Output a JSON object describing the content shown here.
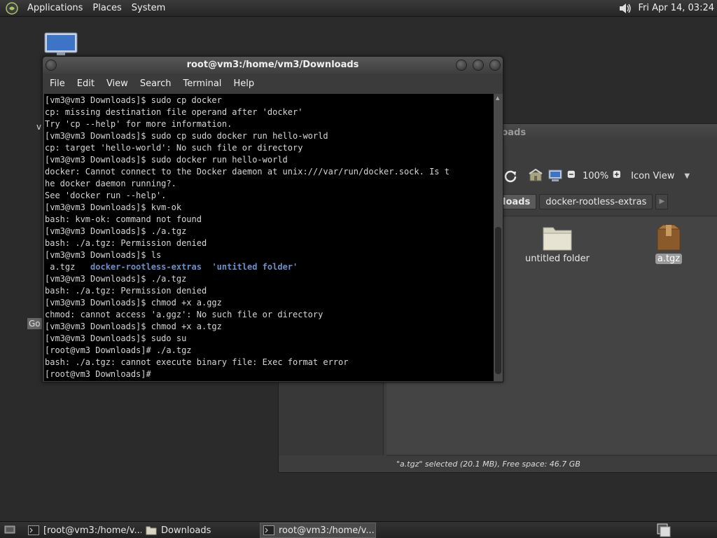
{
  "top_panel": {
    "menus": [
      "Applications",
      "Places",
      "System"
    ],
    "clock": "Fri Apr 14, 03:24"
  },
  "desktop": {
    "fragment_v": "v",
    "fragment_go": "Go"
  },
  "file_manager": {
    "title": "Downloads",
    "zoom": "100%",
    "view_mode": "Icon View",
    "path": [
      "loads",
      "docker-rootless-extras"
    ],
    "items": [
      {
        "name": "untitled folder",
        "type": "folder",
        "selected": false
      },
      {
        "name": "a.tgz",
        "type": "archive",
        "selected": true
      }
    ],
    "status": "\"a.tgz\" selected (20.1 MB), Free space: 46.7 GB"
  },
  "terminal": {
    "title": "root@vm3:/home/vm3/Downloads",
    "menu": [
      "File",
      "Edit",
      "View",
      "Search",
      "Terminal",
      "Help"
    ],
    "lines": [
      "[vm3@vm3 Downloads]$ sudo cp docker",
      "cp: missing destination file operand after 'docker'",
      "Try 'cp --help' for more information.",
      "[vm3@vm3 Downloads]$ sudo cp sudo docker run hello-world",
      "cp: target 'hello-world': No such file or directory",
      "[vm3@vm3 Downloads]$ sudo docker run hello-world",
      "docker: Cannot connect to the Docker daemon at unix:///var/run/docker.sock. Is t",
      "he docker daemon running?.",
      "See 'docker run --help'.",
      "[vm3@vm3 Downloads]$ kvm-ok",
      "bash: kvm-ok: command not found",
      "[vm3@vm3 Downloads]$ ./a.tgz",
      "bash: ./a.tgz: Permission denied",
      "[vm3@vm3 Downloads]$ ls",
      "LS_OUTPUT",
      "[vm3@vm3 Downloads]$ ./a.tgz",
      "bash: ./a.tgz: Permission denied",
      "[vm3@vm3 Downloads]$ chmod +x a.ggz",
      "chmod: cannot access 'a.ggz': No such file or directory",
      "[vm3@vm3 Downloads]$ chmod +x a.tgz",
      "[vm3@vm3 Downloads]$ sudo su",
      "[root@vm3 Downloads]# ./a.tgz",
      "bash: ./a.tgz: cannot execute binary file: Exec format error",
      "[root@vm3 Downloads]#"
    ],
    "ls_output": {
      "file": " a.tgz   ",
      "dir1": "docker-rootless-extras",
      "sep": "  ",
      "dir2": "'untitled folder'"
    }
  },
  "taskbar": {
    "tasks": [
      "[root@vm3:/home/v...",
      "Downloads",
      "root@vm3:/home/v..."
    ]
  },
  "colors": {
    "terminal_bg": "#000000",
    "terminal_fg": "#d6d6d6",
    "directory_blue": "#6b8fc9",
    "panel_bg": "#2b2b2b"
  }
}
